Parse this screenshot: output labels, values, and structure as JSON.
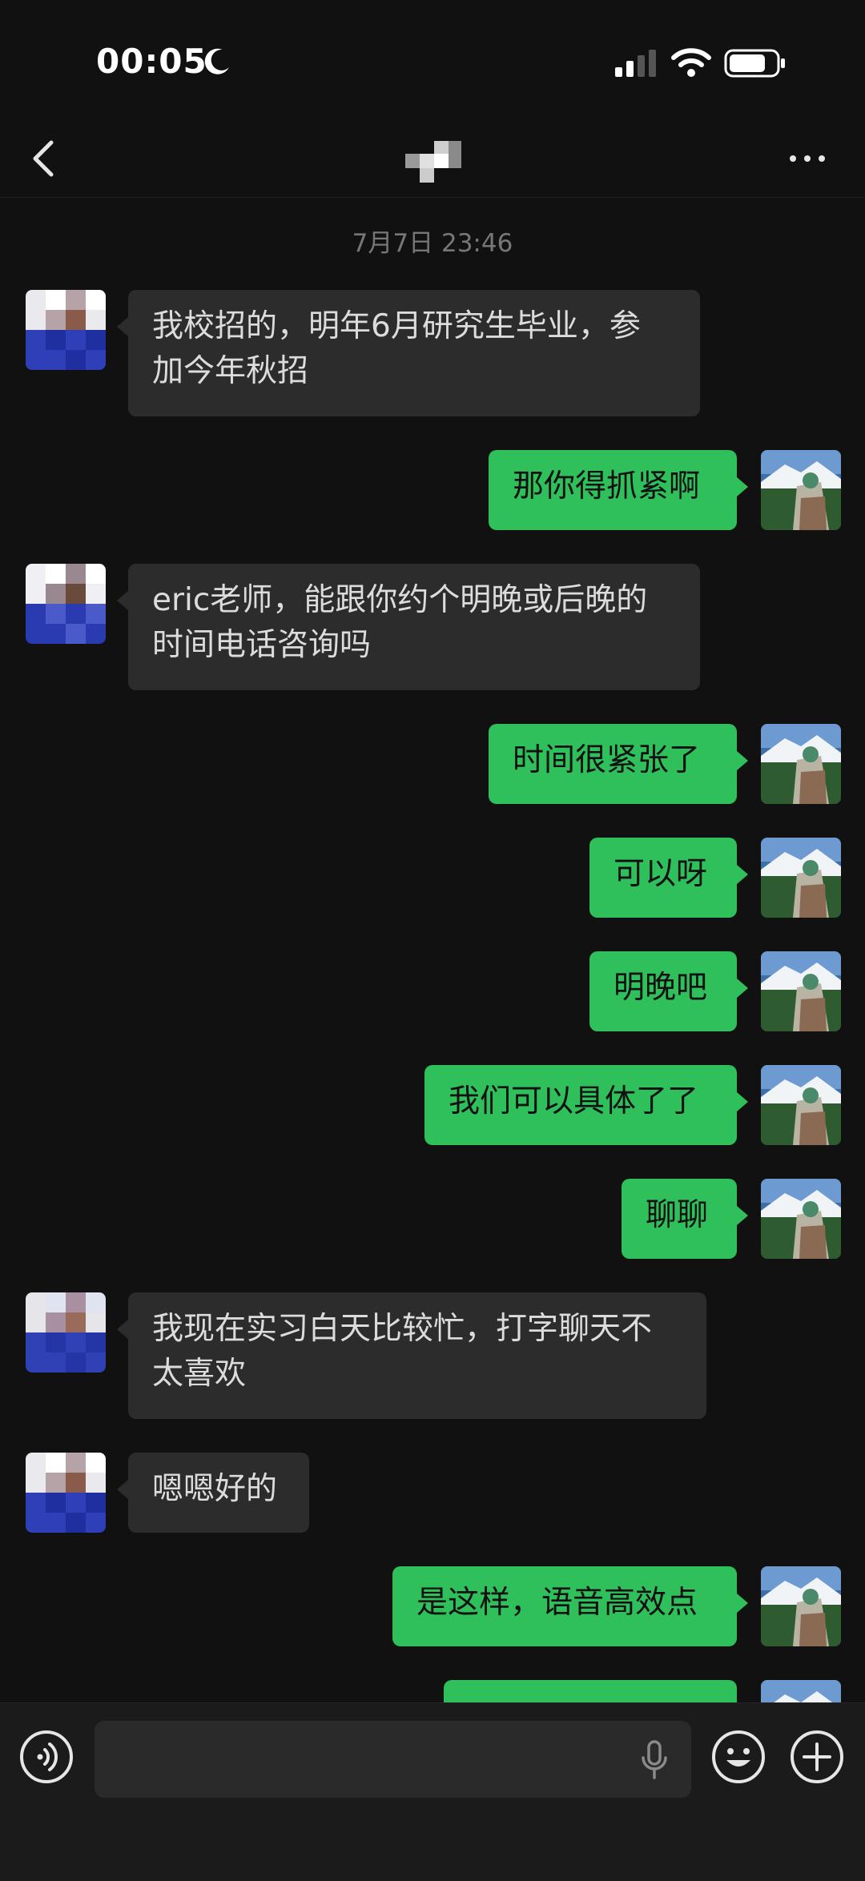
{
  "status_bar": {
    "time": "00:05",
    "moon_icon": "moon-icon",
    "signal_icon": "cellular-signal-icon",
    "wifi_icon": "wifi-icon",
    "battery_icon": "battery-icon"
  },
  "nav": {
    "back_icon": "chevron-left-icon",
    "more_icon": "more-icon"
  },
  "timestamp": "7月7日 23:46",
  "messages": [
    {
      "from": "them",
      "text": "我校招的，明年6月研究生毕业，参\n加今年秋招"
    },
    {
      "from": "me",
      "text": "那你得抓紧啊"
    },
    {
      "from": "them",
      "text": "eric老师，能跟你约个明晚或后晚的\n时间电话咨询吗"
    },
    {
      "from": "me",
      "text": "时间很紧张了"
    },
    {
      "from": "me",
      "text": "可以呀"
    },
    {
      "from": "me",
      "text": "明晚吧"
    },
    {
      "from": "me",
      "text": "我们可以具体了了"
    },
    {
      "from": "me",
      "text": "聊聊"
    },
    {
      "from": "them",
      "text": "我现在实习白天比较忙，打字聊天不\n太喜欢"
    },
    {
      "from": "them",
      "text": "嗯嗯好的"
    },
    {
      "from": "me",
      "text": "是这样，语音高效点"
    },
    {
      "from": "me",
      "text": ""
    }
  ],
  "input_bar": {
    "input_value": "",
    "voice_icon": "voice-icon",
    "mic_icon": "microphone-icon",
    "emoji_icon": "emoji-icon",
    "plus_icon": "plus-icon"
  },
  "colors": {
    "background": "#111111",
    "my_bubble": "#2fbf5b",
    "their_bubble": "#2c2c2c"
  }
}
